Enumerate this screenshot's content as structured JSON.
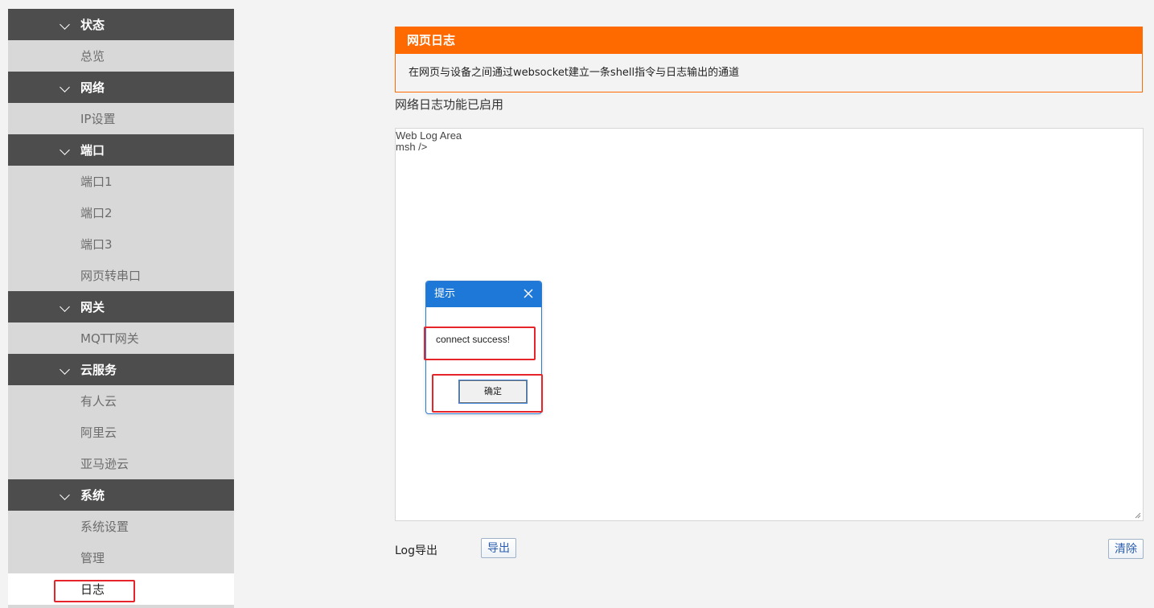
{
  "sidebar": {
    "sections": [
      {
        "label": "状态",
        "items": [
          "总览"
        ]
      },
      {
        "label": "网络",
        "items": [
          "IP设置"
        ]
      },
      {
        "label": "端口",
        "items": [
          "端口1",
          "端口2",
          "端口3",
          "网页转串口"
        ]
      },
      {
        "label": "网关",
        "items": [
          "MQTT网关"
        ]
      },
      {
        "label": "云服务",
        "items": [
          "有人云",
          "阿里云",
          "亚马逊云"
        ]
      },
      {
        "label": "系统",
        "items": [
          "系统设置",
          "管理",
          "日志"
        ]
      }
    ],
    "active_item": "日志"
  },
  "panel": {
    "title": "网页日志",
    "description": "在网页与设备之间通过websocket建立一条shell指令与日志输出的通道"
  },
  "status_text": "网络日志功能已启用",
  "log": {
    "lines": [
      "Web Log Area",
      "msh />"
    ]
  },
  "export": {
    "label": "Log导出",
    "export_button": "导出",
    "clear_button": "清除"
  },
  "dialog": {
    "title": "提示",
    "message": "connect success!",
    "ok_button": "确定"
  },
  "colors": {
    "accent_orange": "#ff6a00",
    "sidebar_group_bg": "#4d4d4d",
    "sidebar_item_bg": "#d8d8d8",
    "dialog_header_blue": "#1e78d7",
    "highlight_red": "#e5252a"
  }
}
